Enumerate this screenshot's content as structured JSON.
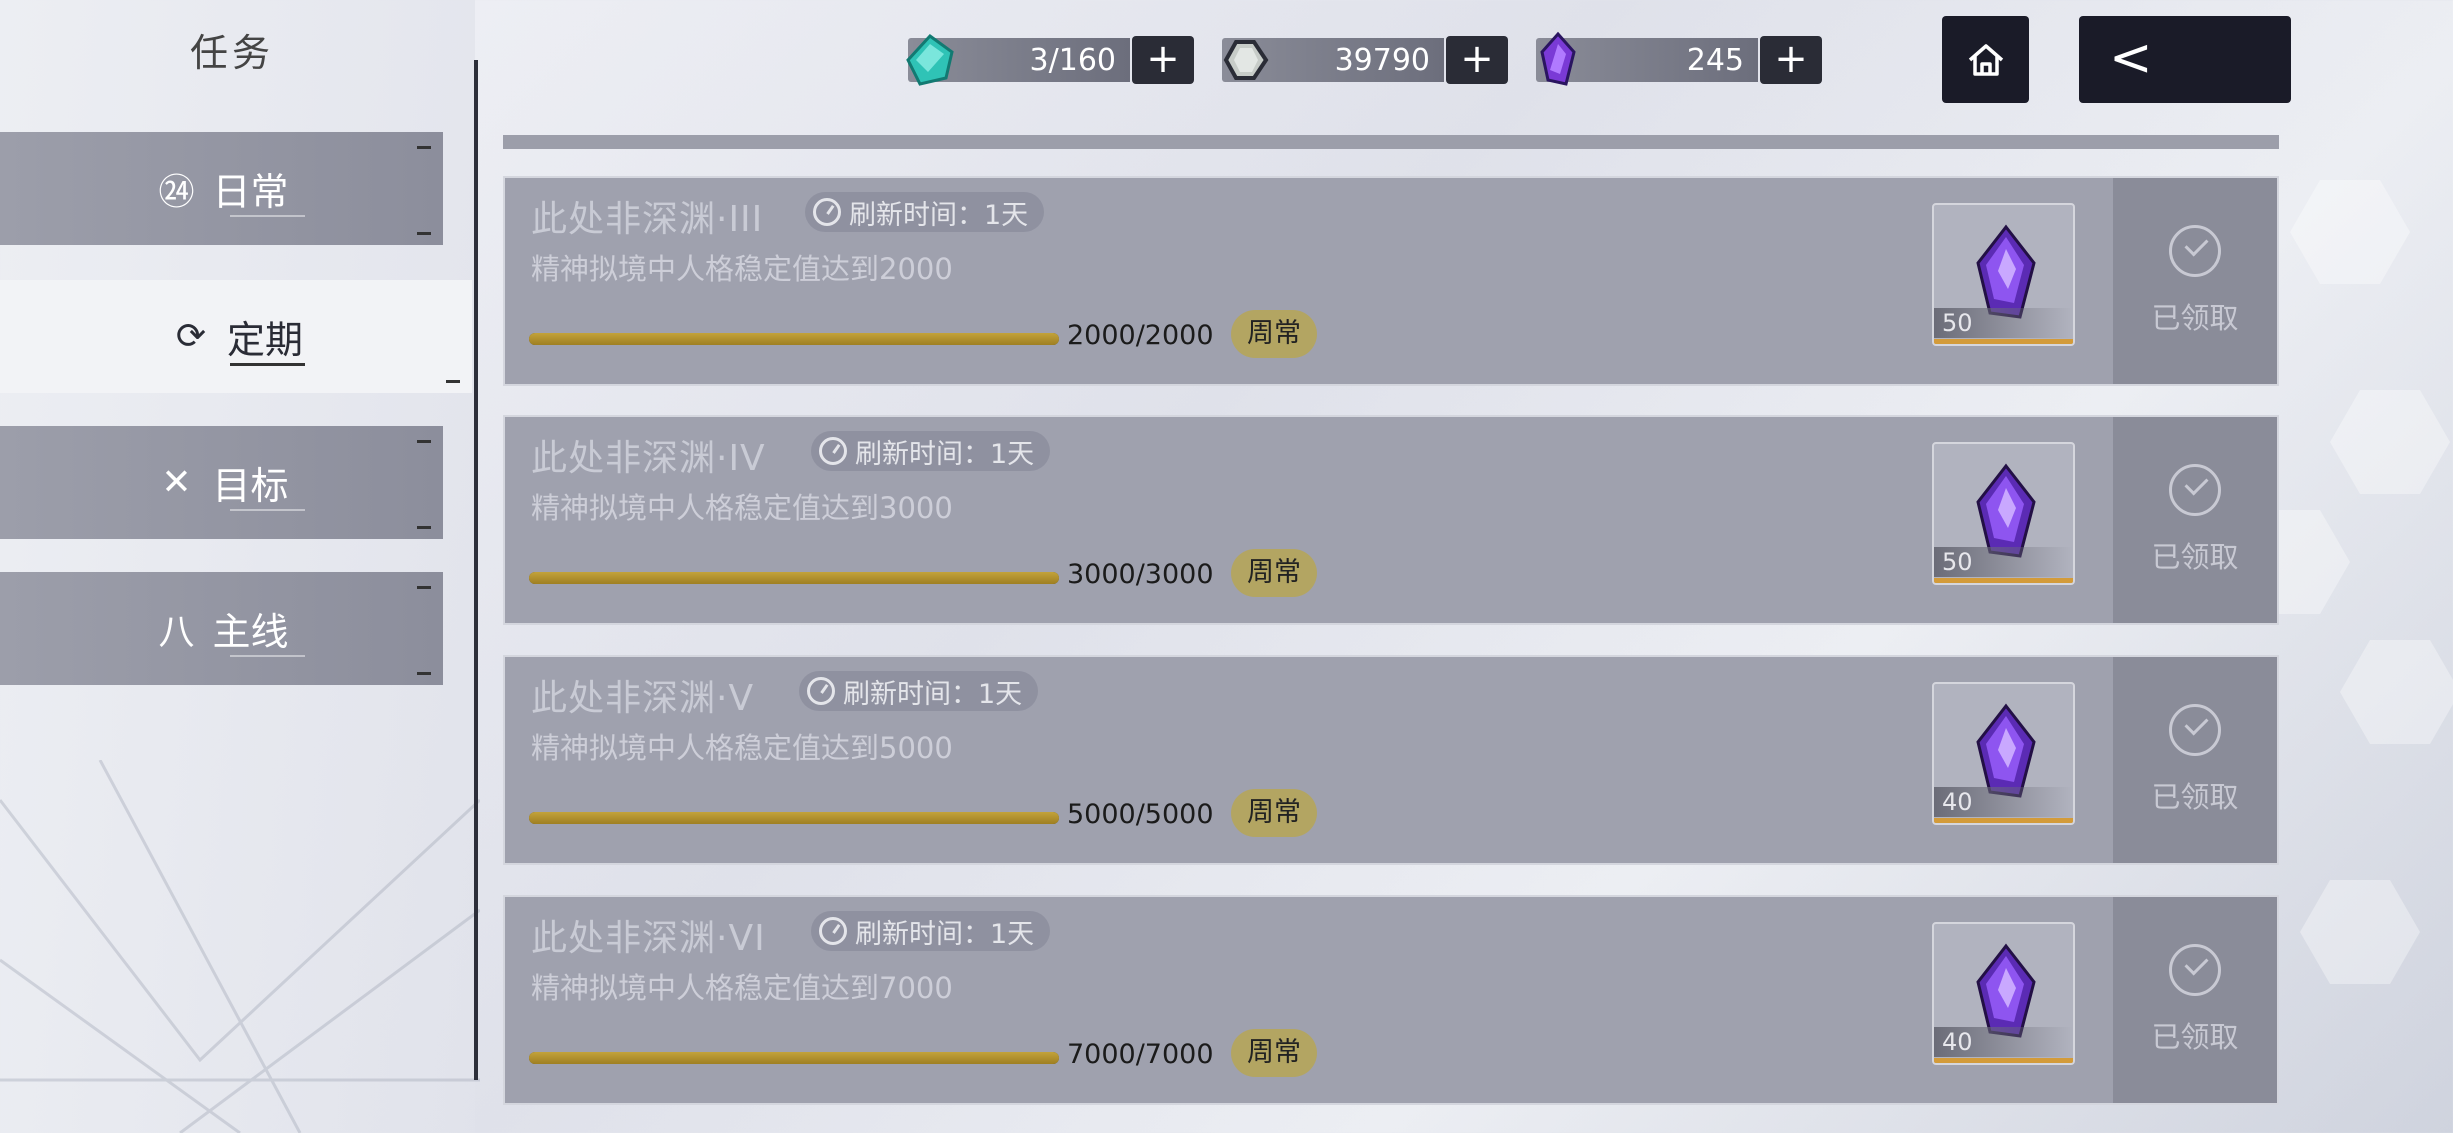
{
  "sidebar": {
    "title": "任务",
    "items": [
      {
        "label": "日常",
        "icon": "24h-icon",
        "glyph": "㉔",
        "active": false
      },
      {
        "label": "定期",
        "icon": "cycle-icon",
        "glyph": "⟳",
        "active": true
      },
      {
        "label": "目标",
        "icon": "target-icon",
        "glyph": "✕",
        "active": false
      },
      {
        "label": "主线",
        "icon": "mainline-icon",
        "glyph": "八",
        "active": false
      }
    ]
  },
  "resources": [
    {
      "name": "stamina",
      "icon": "teal-gem-icon",
      "value": "3/160",
      "color": "#2fc3b6"
    },
    {
      "name": "coins",
      "icon": "silver-coin-icon",
      "value": "39790",
      "color": "#c7ccc8"
    },
    {
      "name": "crystal",
      "icon": "purple-crystal-icon",
      "value": "245",
      "color": "#7a3ad6"
    }
  ],
  "plus_label": "+",
  "home_icon": "home-icon",
  "back_icon": "back-arrow-icon",
  "back_glyph": "<",
  "tasks": [
    {
      "title": "此处非深渊·III",
      "refresh": "刷新时间：1天",
      "desc": "精神拟境中人格稳定值达到2000",
      "progress": "2000/2000",
      "progress_fraction": 1.0,
      "badge": "周常",
      "reward_qty": "50",
      "status": "已领取"
    },
    {
      "title": "此处非深渊·IV",
      "refresh": "刷新时间：1天",
      "desc": "精神拟境中人格稳定值达到3000",
      "progress": "3000/3000",
      "progress_fraction": 1.0,
      "badge": "周常",
      "reward_qty": "50",
      "status": "已领取"
    },
    {
      "title": "此处非深渊·V",
      "refresh": "刷新时间：1天",
      "desc": "精神拟境中人格稳定值达到5000",
      "progress": "5000/5000",
      "progress_fraction": 1.0,
      "badge": "周常",
      "reward_qty": "40",
      "status": "已领取"
    },
    {
      "title": "此处非深渊·VI",
      "refresh": "刷新时间：1天",
      "desc": "精神拟境中人格稳定值达到7000",
      "progress": "7000/7000",
      "progress_fraction": 1.0,
      "badge": "周常",
      "reward_qty": "40",
      "status": "已领取"
    }
  ]
}
